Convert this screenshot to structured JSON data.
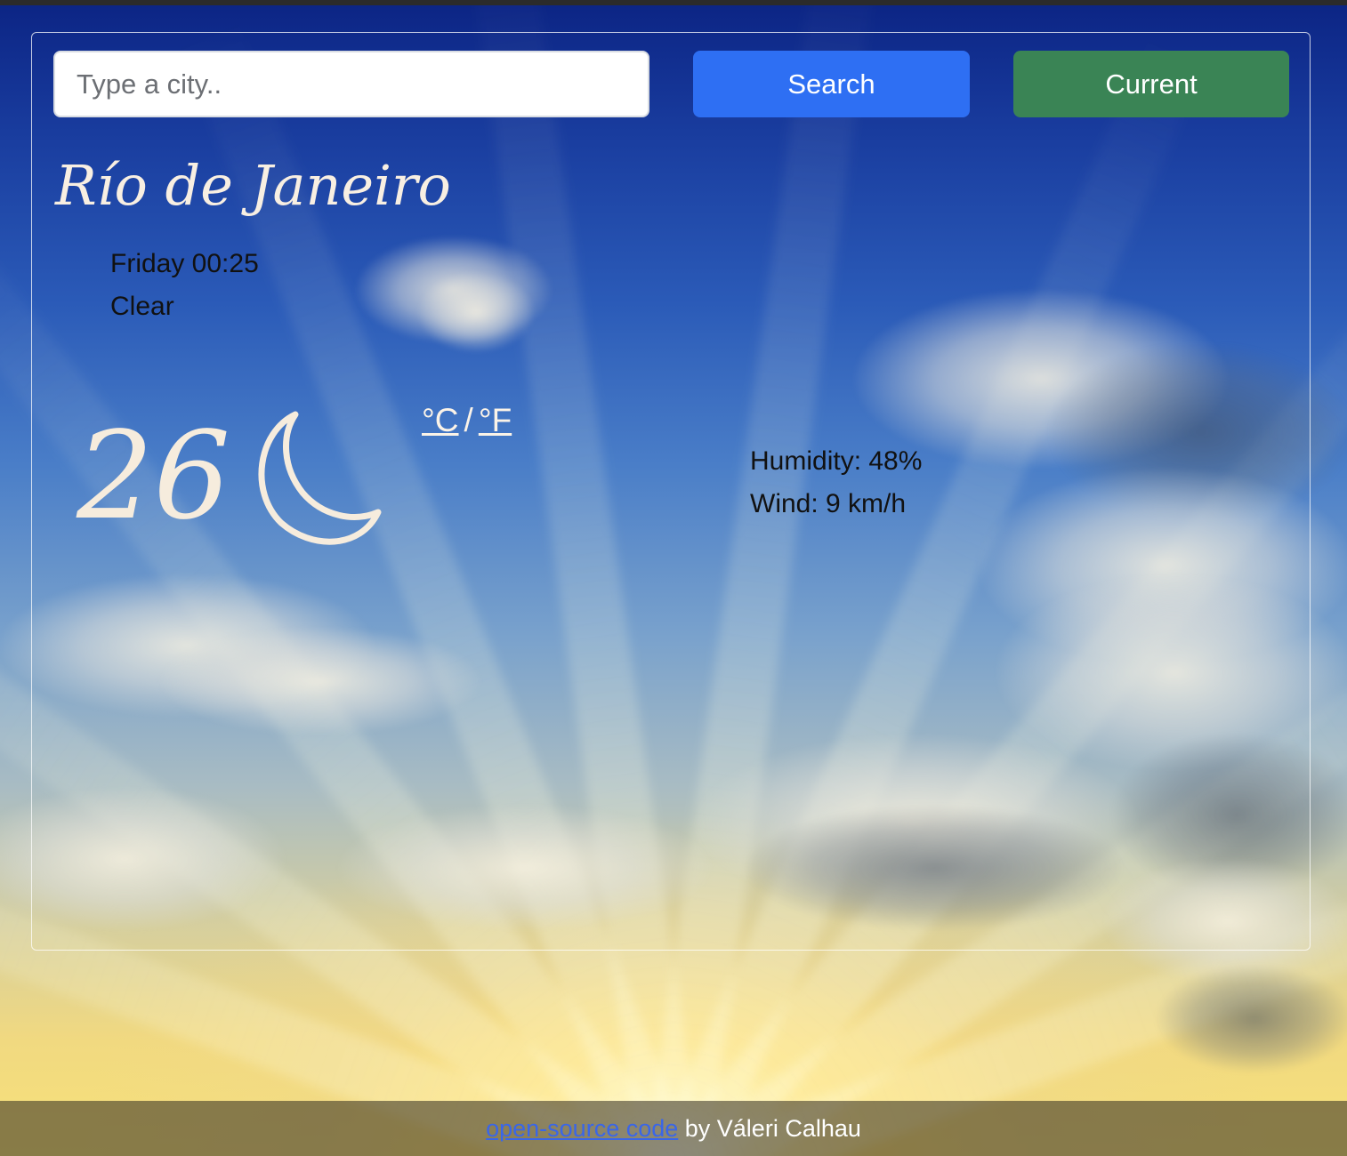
{
  "search": {
    "placeholder": "Type a city..",
    "value": "",
    "search_label": "Search",
    "current_label": "Current"
  },
  "weather": {
    "city": "Río de Janeiro",
    "datetime": "Friday 00:25",
    "description": "Clear",
    "temperature": "26",
    "icon": "moon-icon",
    "unit_celsius": "°C",
    "unit_separator": "/",
    "unit_fahrenheit": "°F",
    "humidity": "Humidity: 48%",
    "wind": "Wind: 9 km/h"
  },
  "footer": {
    "link_text": "open-source code",
    "author_text": " by Váleri Calhau"
  },
  "colors": {
    "search_button": "#2e6ff3",
    "current_button": "#3a8455",
    "link": "#3a66e8",
    "heading_text": "#f8efe2"
  }
}
